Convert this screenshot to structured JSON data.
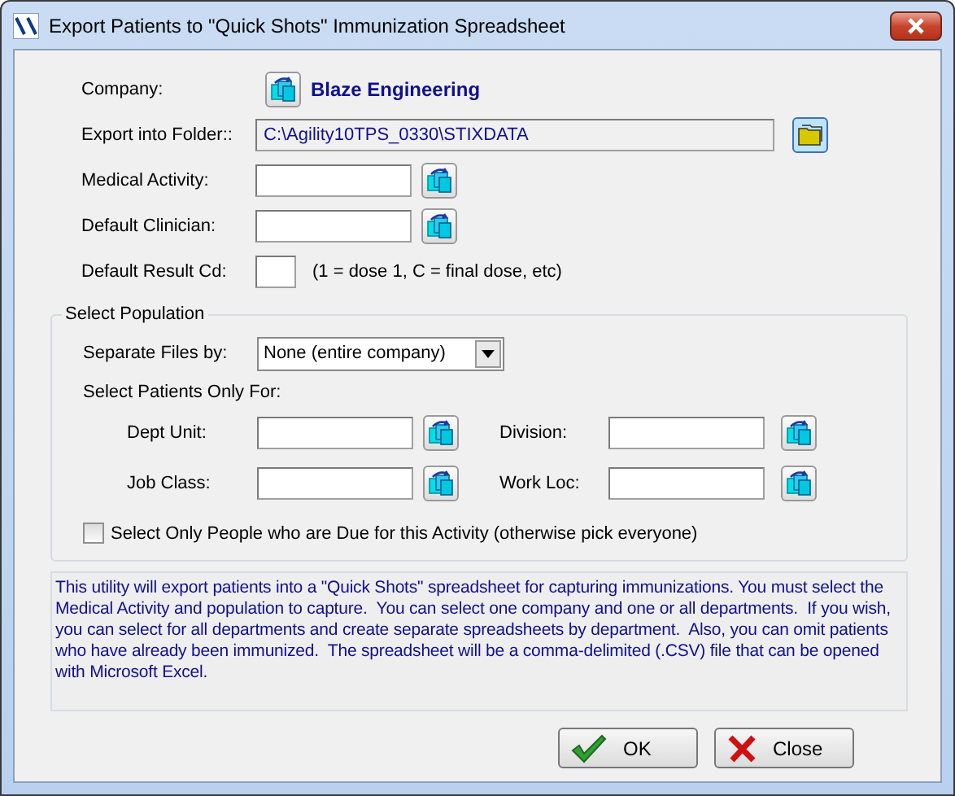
{
  "window": {
    "title": "Export Patients to \"Quick Shots\" Immunization Spreadsheet"
  },
  "company": {
    "label": "Company:",
    "value": "Blaze Engineering"
  },
  "export_folder": {
    "label": "Export into Folder::",
    "value": "C:\\Agility10TPS_0330\\STIXDATA"
  },
  "fields": [
    {
      "label": "Medical Activity:",
      "kind": "lookup"
    },
    {
      "label": "Default Clinician:",
      "kind": "lookup"
    },
    {
      "label": "Default Result Cd:",
      "kind": "short",
      "note": "(1 = dose 1, C = final dose, etc)"
    }
  ],
  "population": {
    "title": "Select Population",
    "separate_files": {
      "label": "Separate Files by:",
      "value": "None (entire company)"
    },
    "filters_title": "Select Patients Only For:",
    "filters": [
      {
        "label": "Dept Unit:"
      },
      {
        "label": "Division:"
      },
      {
        "label": "Job Class:"
      },
      {
        "label": "Work Loc:"
      }
    ],
    "due_only": {
      "label": "Select Only People who are Due for this Activity (otherwise pick everyone)",
      "checked": false
    }
  },
  "description": "This utility will export patients into a \"Quick Shots\" spreadsheet for capturing immunizations. You must select the Medical Activity and population to capture.  You can select one company and one or all departments.  If you wish, you can select for all departments and create separate spreadsheets by department.  Also, you can omit patients who have already been immunized.  The spreadsheet will be a comma-delimited (.CSV) file that can be opened with Microsoft Excel.",
  "buttons": [
    {
      "label": "OK",
      "kind": "ok"
    },
    {
      "label": "Close",
      "kind": "close"
    }
  ]
}
